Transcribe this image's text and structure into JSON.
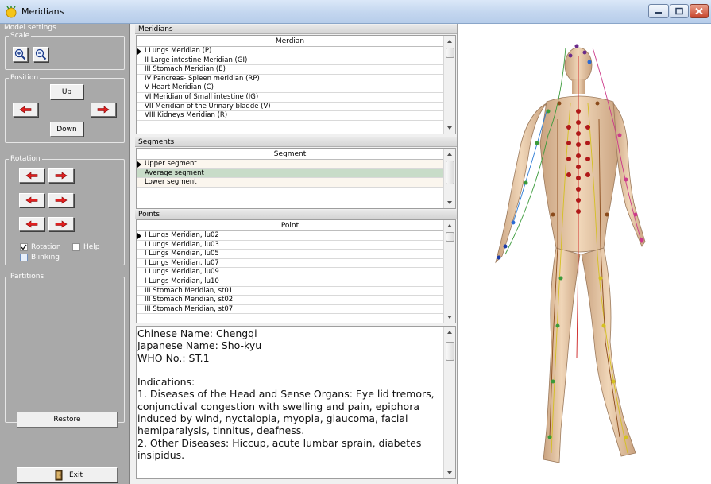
{
  "window": {
    "title": "Meridians"
  },
  "left": {
    "model_settings": "Model settings",
    "scale": {
      "label": "Scale",
      "zoom_in": "zoom-in",
      "zoom_out": "zoom-out"
    },
    "position": {
      "label": "Position",
      "up": "Up",
      "down": "Down"
    },
    "rotation": {
      "label": "Rotation",
      "rotation_checkbox": {
        "label": "Rotation",
        "checked": true
      },
      "help_checkbox": {
        "label": "Help",
        "checked": false
      },
      "blinking_checkbox": {
        "label": "Blinking",
        "checked": false
      }
    },
    "partitions": {
      "label": "Partitions"
    },
    "restore": "Restore",
    "exit": "Exit"
  },
  "meridians": {
    "caption": "Meridians",
    "column": "Merdian",
    "rows": [
      "I Lungs Meridian (P)",
      "II Large intestine Meridian (GI)",
      "III Stomach Meridian (E)",
      "IV Pancreas- Spleen meridian (RP)",
      "V Heart Meridian (C)",
      "VI Meridian of Small intestine (IG)",
      "VII Meridian of the Urinary bladde (V)",
      "VIII Kidneys Meridian (R)"
    ]
  },
  "segments": {
    "caption": "Segments",
    "column": "Segment",
    "rows": [
      "Upper segment",
      "Average segment",
      "Lower segment"
    ]
  },
  "points": {
    "caption": "Points",
    "column": "Point",
    "rows": [
      "I Lungs Meridian, lu02",
      "I Lungs Meridian, lu03",
      "I Lungs Meridian, lu05",
      "I Lungs Meridian, lu07",
      "I Lungs Meridian, lu09",
      "I Lungs Meridian, lu10",
      "III Stomach Meridian, st01",
      "III Stomach Meridian, st02",
      "III Stomach Meridian, st07"
    ]
  },
  "details": {
    "text": "Chinese Name: Chengqi\nJapanese Name: Sho-kyu\nWHO No.: ST.1\n\nIndications:\n1. Diseases of the Head and Sense Organs: Eye lid tremors, conjunctival congestion with swelling and pain, epiphora induced by wind, nyctalopia, myopia, glaucoma, facial hemiparalysis, tinnitus, deafness.\n2. Other Diseases: Hiccup, acute lumbar sprain, diabetes insipidus."
  },
  "colors": {
    "panel": "#a9a9a9",
    "selected_row": "#c8dcc8",
    "arrow_red": "#e02020",
    "skin": "#e8c9a6"
  }
}
